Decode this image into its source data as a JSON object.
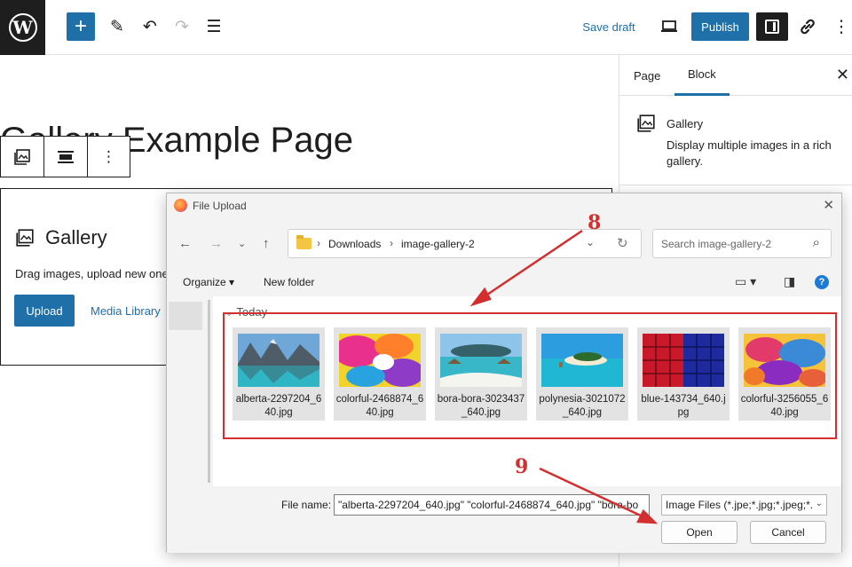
{
  "editor": {
    "post_title": "Gallery Example Page",
    "topbar": {
      "save_draft": "Save draft",
      "publish": "Publish"
    },
    "gallery_block": {
      "title": "Gallery",
      "description": "Drag images, upload new one",
      "upload": "Upload",
      "media_library": "Media Library"
    }
  },
  "sidebar": {
    "tabs": [
      "Page",
      "Block"
    ],
    "active_tab": "Block",
    "block_name": "Gallery",
    "block_description": "Display multiple images in a rich gallery."
  },
  "dialog": {
    "title": "File Upload",
    "breadcrumb": [
      "Downloads",
      "image-gallery-2"
    ],
    "search_placeholder": "Search image-gallery-2",
    "organize": "Organize",
    "new_folder": "New folder",
    "group_label": "Today",
    "files": [
      {
        "name": "alberta-2297204_640.jpg",
        "thumb": "lake-mountains"
      },
      {
        "name": "colorful-2468874_640.jpg",
        "thumb": "paint-splash"
      },
      {
        "name": "bora-bora-3023437_640.jpg",
        "thumb": "overwater-bungalows"
      },
      {
        "name": "polynesia-3021072_640.jpg",
        "thumb": "tropical-island"
      },
      {
        "name": "blue-143734_640.jpg",
        "thumb": "red-blue-cubes"
      },
      {
        "name": "colorful-3256055_640.jpg",
        "thumb": "abstract-color"
      }
    ],
    "file_name_label": "File name:",
    "file_name_value": "\"alberta-2297204_640.jpg\" \"colorful-2468874_640.jpg\" \"bora-bo",
    "file_type": "Image Files (*.jpe;*.jpg;*.jpeg;*.",
    "open": "Open",
    "cancel": "Cancel"
  },
  "annotations": {
    "step_8": "8",
    "step_9": "9",
    "color": "#d32f2f"
  },
  "colors": {
    "accent": "#1f6fa8",
    "dark": "#1e1e1e",
    "highlight": "#d32f2f"
  }
}
